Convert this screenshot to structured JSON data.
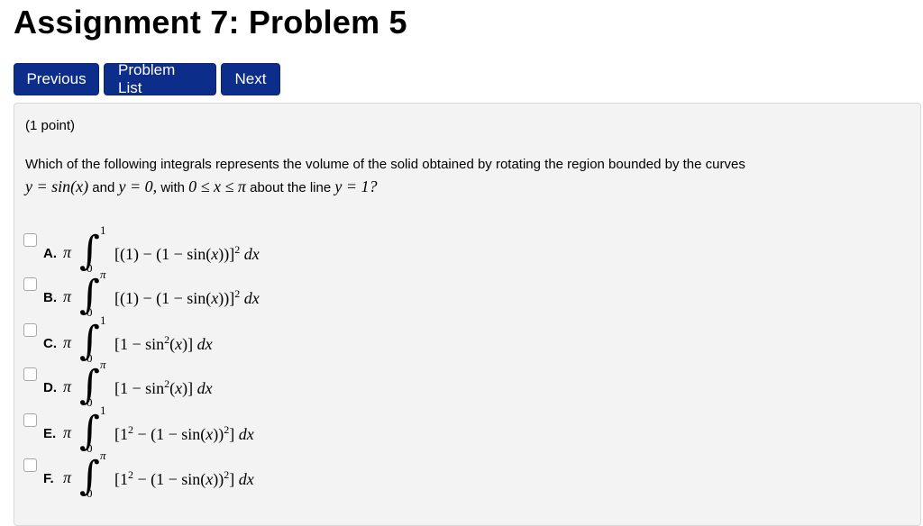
{
  "page": {
    "title": "Assignment 7: Problem 5"
  },
  "nav": {
    "previous_label": "Previous",
    "problem_list_label": "Problem List",
    "next_label": "Next",
    "button_color": "#0d2d8a"
  },
  "problem": {
    "points": "(1 point)",
    "question_text": "Which of the following integrals represents the volume of the solid obtained by rotating the region bounded by the curves",
    "eq1": "y = sin(x)",
    "and_text": "and",
    "eq2": "y = 0,",
    "with_text": "with",
    "range": "0 ≤ x ≤ π",
    "about_text": "about the line",
    "line_eq": "y = 1?"
  },
  "options": [
    {
      "label": "A.",
      "lead": "π",
      "upper": "1",
      "lower": "0",
      "integrand_html": "[(1) − (1 − sin(<i>x</i>))]<sup>2</sup> <i>dx</i>"
    },
    {
      "label": "B.",
      "lead": "π",
      "upper": "π",
      "lower": "0",
      "integrand_html": "[(1) − (1 − sin(<i>x</i>))]<sup>2</sup> <i>dx</i>"
    },
    {
      "label": "C.",
      "lead": "π",
      "upper": "1",
      "lower": "0",
      "integrand_html": "[1 − sin<sup>2</sup>(<i>x</i>)] <i>dx</i>"
    },
    {
      "label": "D.",
      "lead": "π",
      "upper": "π",
      "lower": "0",
      "integrand_html": "[1 − sin<sup>2</sup>(<i>x</i>)] <i>dx</i>"
    },
    {
      "label": "E.",
      "lead": "π",
      "upper": "1",
      "lower": "0",
      "integrand_html": "[1<sup>2</sup> − (1 − sin(<i>x</i>))<sup>2</sup>] <i>dx</i>"
    },
    {
      "label": "F.",
      "lead": "π",
      "upper": "π",
      "lower": "0",
      "integrand_html": "[1<sup>2</sup> − (1 − sin(<i>x</i>))<sup>2</sup>] <i>dx</i>"
    }
  ]
}
